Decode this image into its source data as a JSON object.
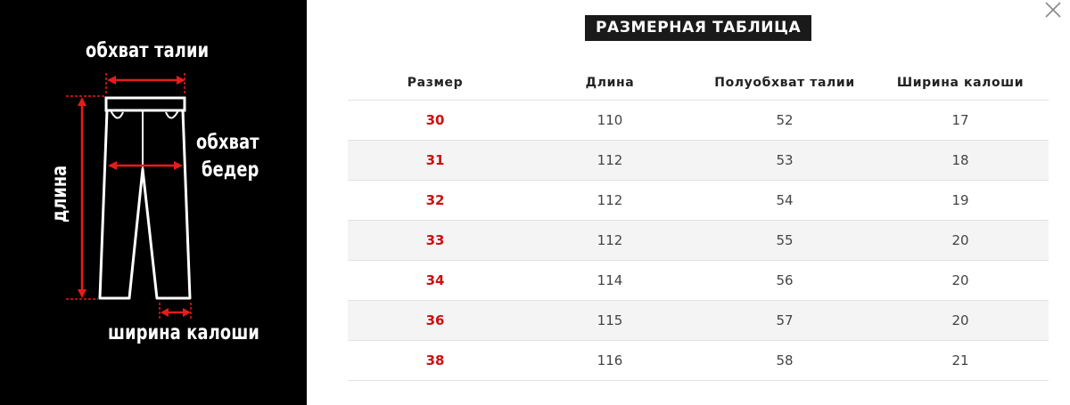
{
  "colors": {
    "panel_bg": "#000000",
    "accent_red": "#cc1111",
    "title_bg": "#1a1a1a",
    "row_alt": "#f4f4f4"
  },
  "diagram": {
    "waist_label": "обхват талии",
    "hips_label_line1": "обхват",
    "hips_label_line2": "бедер",
    "length_label": "длина",
    "leg_label": "ширина калоши"
  },
  "title": "РАЗМЕРНАЯ ТАБЛИЦА",
  "close_icon": "close-icon",
  "table": {
    "headers": [
      "Размер",
      "Длина",
      "Полуобхват талии",
      "Ширина калоши"
    ],
    "rows": [
      [
        "30",
        "110",
        "52",
        "17"
      ],
      [
        "31",
        "112",
        "53",
        "18"
      ],
      [
        "32",
        "112",
        "54",
        "19"
      ],
      [
        "33",
        "112",
        "55",
        "20"
      ],
      [
        "34",
        "114",
        "56",
        "20"
      ],
      [
        "36",
        "115",
        "57",
        "20"
      ],
      [
        "38",
        "116",
        "58",
        "21"
      ]
    ]
  }
}
